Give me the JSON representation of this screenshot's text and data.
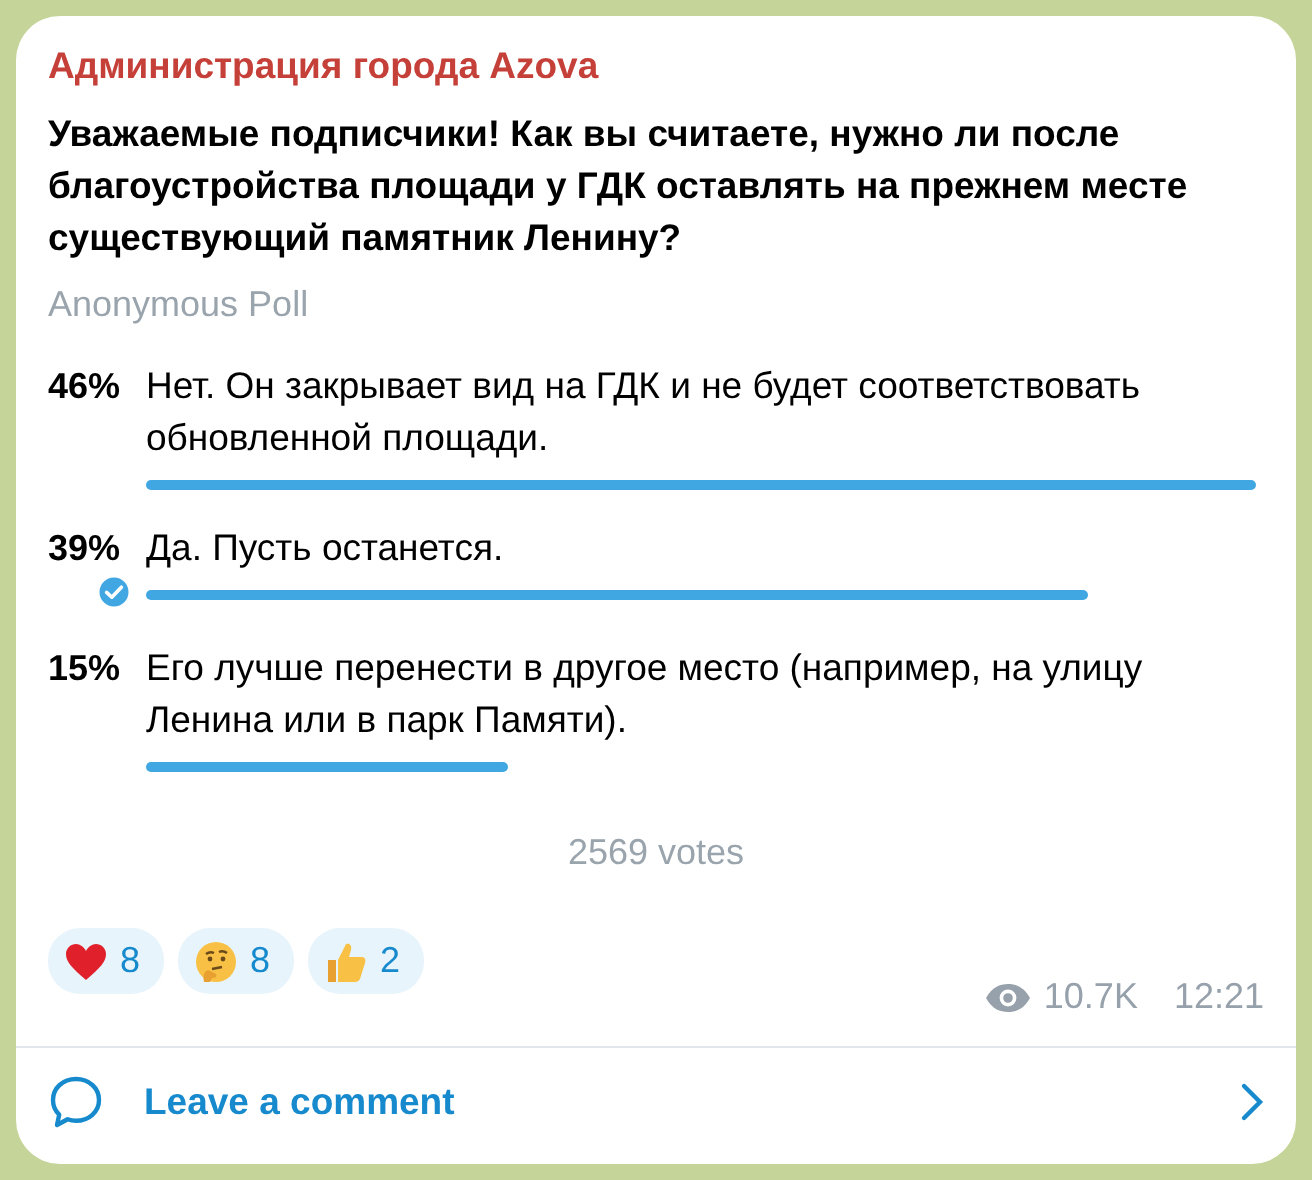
{
  "channel": {
    "name": "Администрация города Azova"
  },
  "poll": {
    "question": "Уважаемые подписчики! Как вы считаете, нужно ли после благоустройства площади у ГДК оставлять на прежнем месте существующий памятник Ленину?",
    "type_label": "Anonymous Poll",
    "options": [
      {
        "percent": "46%",
        "text": "Нет. Он закрывает вид на ГДК и не будет соответствовать обновленной площади.",
        "selected": false
      },
      {
        "percent": "39%",
        "text": "Да. Пусть останется.",
        "selected": true
      },
      {
        "percent": "15%",
        "text": "Его лучше перенести в другое место (например, на улицу Ленина или в парк Памяти).",
        "selected": false
      }
    ],
    "votes": "2569 votes"
  },
  "reactions": [
    {
      "kind": "heart",
      "count": "8"
    },
    {
      "kind": "thinking",
      "count": "8"
    },
    {
      "kind": "thumbs-up",
      "count": "2"
    }
  ],
  "views": "10.7K",
  "time": "12:21",
  "comment_link": "Leave a comment"
}
